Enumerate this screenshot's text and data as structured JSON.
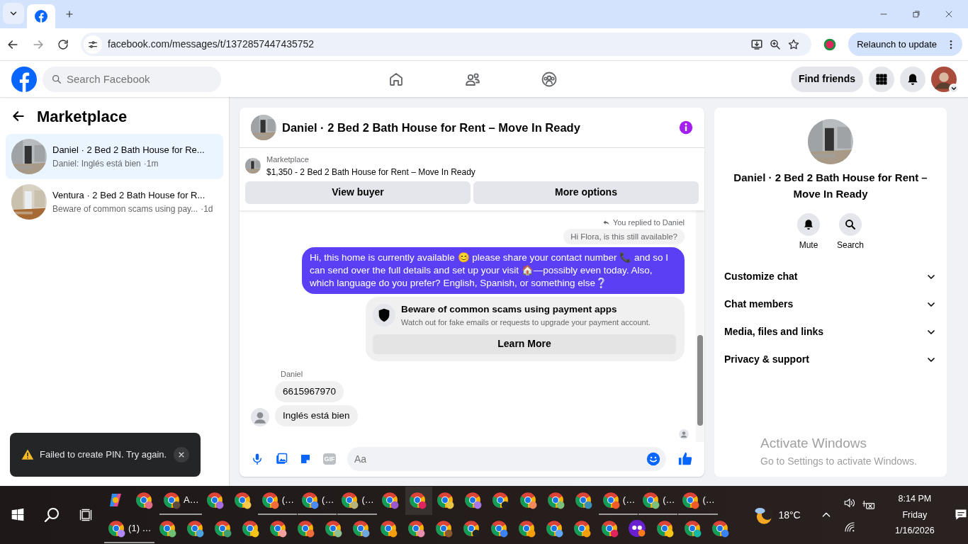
{
  "browser": {
    "tabs": [
      {
        "selected": true
      }
    ],
    "url": "facebook.com/messages/t/1372857447435752",
    "relaunch_button": "Relaunch to update"
  },
  "header": {
    "search": {
      "placeholder": "Search Facebook"
    },
    "find_friends": "Find friends"
  },
  "sidebar": {
    "title": "Marketplace",
    "conversations": [
      {
        "title": "Daniel · 2 Bed 2 Bath House for Re...",
        "preview": "Daniel: Inglés está bien",
        "time": "·1m",
        "selected": true,
        "kind": "grey"
      },
      {
        "title": "Ventura · 2 Bed 2 Bath House for R...",
        "preview": "Beware of common scams using pay...",
        "time": "·1d",
        "selected": false,
        "kind": "wood"
      }
    ]
  },
  "chat": {
    "title": "Daniel · 2 Bed 2 Bath House for Rent – Move In Ready",
    "listing": {
      "source": "Marketplace",
      "title": "$1,350 - 2 Bed 2 Bath House for Rent – Move In Ready"
    },
    "buttons": [
      "View buyer",
      "More options"
    ],
    "messages": [
      {
        "kind": "reply_note",
        "text": "You replied to Daniel"
      },
      {
        "kind": "quoted",
        "text": "Hi Flora, is this still available?"
      },
      {
        "kind": "outgoing",
        "text": "Hi, this home is currently available 😊 please share your contact number 📞 and  so I can send over the full details and set up your visit 🏠—possibly even today. Also, which language do you prefer? English, Spanish, or something else❔"
      },
      {
        "kind": "notice",
        "title": "Beware of common scams using payment apps",
        "text": "Watch out for fake emails or requests to upgrade your payment account.",
        "button": "Learn More"
      },
      {
        "kind": "sender",
        "text": "Daniel"
      },
      {
        "kind": "incoming",
        "text": "6615967970",
        "avatar": false
      },
      {
        "kind": "incoming",
        "text": "Inglés está bien",
        "avatar": true
      }
    ],
    "composer": {
      "placeholder": "Aa",
      "gif_label": "GIF"
    }
  },
  "details": {
    "title": "Daniel · 2 Bed 2 Bath House for Rent – Move In Ready",
    "actions": [
      {
        "label": "Mute",
        "kind": "mute"
      },
      {
        "label": "Search",
        "kind": "search"
      }
    ],
    "sections": [
      {
        "label": "Customize chat",
        "expanded": false
      },
      {
        "label": "Chat members",
        "expanded": false
      },
      {
        "label": "Media, files and links",
        "expanded": false
      },
      {
        "label": "Privacy & support",
        "expanded": false
      }
    ]
  },
  "toast": {
    "text": "Failed to create PIN. Try again."
  },
  "watermark": {
    "title": "Activate Windows",
    "text": "Go to Settings to activate Windows."
  },
  "taskbar": {
    "rows": [
      [
        {
          "kind": "copilot",
          "selected": false
        },
        {
          "kind": "chrome",
          "color": "#e26a8a",
          "selected": false
        },
        {
          "kind": "chrome",
          "color": "#5a4a40",
          "label": "A…",
          "selected": false
        },
        {
          "kind": "chrome",
          "color": "#a56be0",
          "selected": false
        },
        {
          "kind": "chrome",
          "color": "#f2c94c",
          "selected": false
        },
        {
          "kind": "chrome",
          "color": "#f26b3a",
          "label": "(…",
          "selected": false
        },
        {
          "kind": "chrome",
          "color": "#4b8bf5",
          "label": "(…",
          "selected": false
        },
        {
          "kind": "chrome",
          "color": "#b8b27a",
          "label": "(…",
          "selected": false
        },
        {
          "kind": "chrome",
          "color": "#9b59d0",
          "selected": false
        },
        {
          "kind": "chrome",
          "color": "#e0245e",
          "selected": true
        },
        {
          "kind": "chrome",
          "color": "#e8c547",
          "selected": false
        },
        {
          "kind": "chrome",
          "color": "#a678e8",
          "selected": false
        },
        {
          "kind": "chrome",
          "color": "#222222",
          "selected": false
        },
        {
          "kind": "chrome",
          "color": "#f08a5d",
          "selected": false
        },
        {
          "kind": "chrome",
          "color": "#7cbf7c",
          "selected": false
        },
        {
          "kind": "chrome",
          "color": "#3a8fb7",
          "selected": false
        },
        {
          "kind": "chrome",
          "color": "#f05a28",
          "label": "(…",
          "selected": false
        },
        {
          "kind": "chrome",
          "color": "#7cbf7c",
          "label": "(…",
          "selected": false
        },
        {
          "kind": "chrome",
          "color": "#f05a28",
          "label": "(…",
          "selected": false
        }
      ],
      [
        {
          "kind": "chrome",
          "color": "#b388ff",
          "label": "(1) …",
          "selected": false
        },
        {
          "kind": "chrome",
          "color": "#6fbf73",
          "selected": false
        },
        {
          "kind": "chrome",
          "color": "#4aa3df",
          "selected": false
        },
        {
          "kind": "chrome",
          "color": "#3f9f6f",
          "selected": false
        },
        {
          "kind": "chrome",
          "color": "#f5c518",
          "selected": false
        },
        {
          "kind": "chrome",
          "color": "#f4a0a0",
          "selected": false
        },
        {
          "kind": "chrome",
          "color": "#f26b3a",
          "selected": false
        },
        {
          "kind": "chrome",
          "color": "#8fbf8f",
          "selected": false
        },
        {
          "kind": "chrome",
          "color": "#6fa8dc",
          "selected": false
        },
        {
          "kind": "chrome",
          "color": "#f59e0b",
          "selected": false
        },
        {
          "kind": "chrome",
          "color": "#e88fb0",
          "selected": false
        },
        {
          "kind": "chrome",
          "color": "#8b5a2b",
          "selected": false
        },
        {
          "kind": "chrome",
          "color": "#222222",
          "selected": false
        },
        {
          "kind": "chrome",
          "color": "#3b82f6",
          "selected": false
        },
        {
          "kind": "chrome",
          "color": "#f59e0b",
          "selected": false
        },
        {
          "kind": "chrome",
          "color": "#60a5fa",
          "selected": false
        },
        {
          "kind": "chrome",
          "color": "#f59e0b",
          "selected": false
        },
        {
          "kind": "chrome",
          "color": "#e0245e",
          "selected": false
        },
        {
          "kind": "app",
          "color": "#6a1fd0",
          "selected": false
        },
        {
          "kind": "chrome",
          "color": "#f5c518",
          "selected": false
        },
        {
          "kind": "chrome",
          "color": "#14b8a6",
          "selected": false
        },
        {
          "kind": "chrome",
          "color": "#3b82f6",
          "selected": false
        }
      ]
    ],
    "weather": "18°C",
    "time": "8:14 PM",
    "day": "Friday",
    "date": "1/16/2026"
  }
}
